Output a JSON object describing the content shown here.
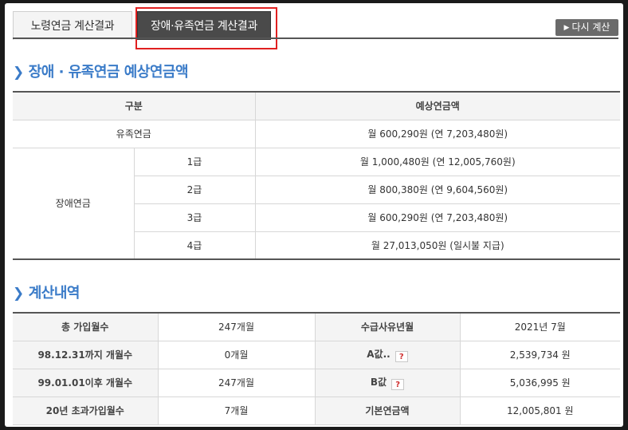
{
  "tabs": {
    "old_age": "노령연금 계산결과",
    "disability_survivor": "장애·유족연금 계산결과",
    "recalc": "다시 계산"
  },
  "section1": {
    "title": "장애 · 유족연금 예상연금액",
    "header_category": "구분",
    "header_amount": "예상연금액",
    "survivor_label": "유족연금",
    "survivor_amount": "월 600,290원 (연 7,203,480원)",
    "disability_label": "장애연금",
    "grades": [
      {
        "grade": "1급",
        "amount": "월 1,000,480원 (연 12,005,760원)"
      },
      {
        "grade": "2급",
        "amount": "월 800,380원 (연 9,604,560원)"
      },
      {
        "grade": "3급",
        "amount": "월 600,290원 (연 7,203,480원)"
      },
      {
        "grade": "4급",
        "amount": "월 27,013,050원 (일시불 지급)"
      }
    ]
  },
  "section2": {
    "title": "계산내역",
    "rows": [
      {
        "l1": "총 가입월수",
        "v1": "247개월",
        "l2": "수급사유년월",
        "v2": "2021년 7월"
      },
      {
        "l1": "98.12.31까지 개월수",
        "v1": "0개월",
        "l2": "A값..",
        "v2": "2,539,734 원"
      },
      {
        "l1": "99.01.01이후 개월수",
        "v1": "247개월",
        "l2": "B값",
        "v2": "5,036,995 원"
      },
      {
        "l1": "20년 초과가입월수",
        "v1": "7개월",
        "l2": "기본연금액",
        "v2": "12,005,801 원"
      }
    ],
    "help_symbol": "?"
  },
  "colors": {
    "accent": "#3a7bc8",
    "tab_active": "#4a4a4a",
    "highlight": "#e02020"
  }
}
